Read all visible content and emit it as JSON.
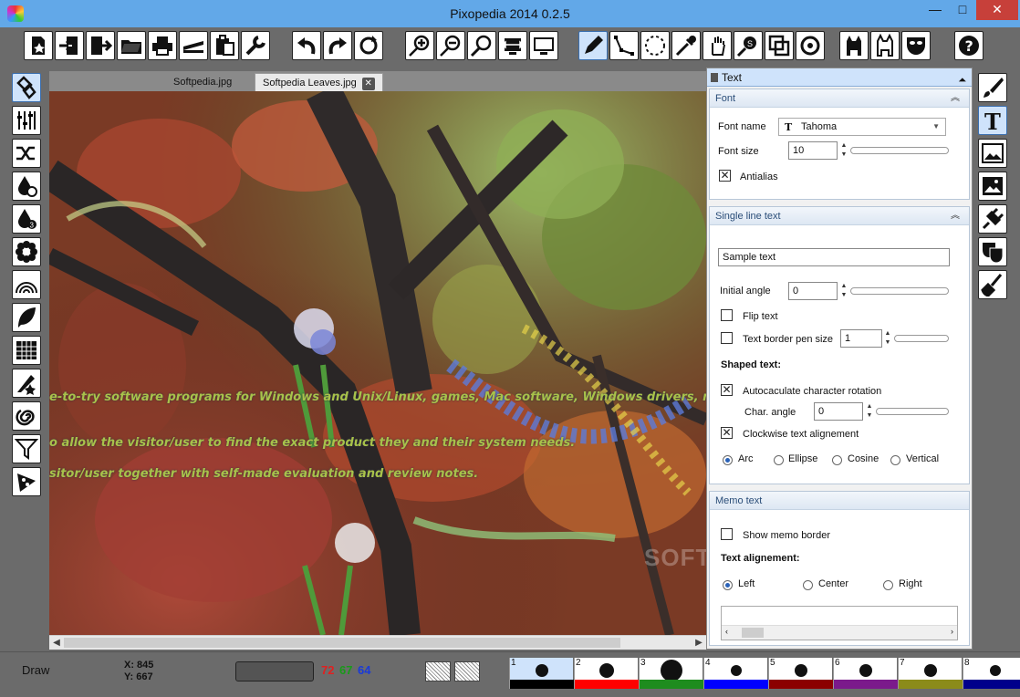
{
  "window": {
    "title": "Pixopedia 2014 0.2.5",
    "min": "—",
    "max": "□",
    "close": "✕"
  },
  "toolbar_icons": [
    "new-icon",
    "import-icon",
    "export-icon",
    "open-folder-icon",
    "print-icon",
    "scanner-icon",
    "clipboard-icon",
    "wrench-icon",
    "undo-icon",
    "redo-icon",
    "refresh-icon",
    "zoom-in-icon",
    "zoom-out-icon",
    "zoom-icon",
    "fit-width-icon",
    "monitor-icon",
    "pen-icon",
    "path-icon",
    "lasso-icon",
    "eyedropper-icon",
    "hand-icon",
    "stamp-icon",
    "crop-icon",
    "rotate-icon",
    "cat-black-icon",
    "cat-white-icon",
    "mask-icon",
    "help-icon"
  ],
  "tabs": [
    {
      "label": "Softpedia.jpg",
      "active": false
    },
    {
      "label": "Softpedia Leaves.jpg",
      "active": true,
      "close": "✕"
    }
  ],
  "canvas": {
    "overlay_lines": [
      "e-to-try software programs for Windows and Unix/Linux, games, Mac software, Windows drivers, mobile",
      "o allow the visitor/user to find the exact product they and their system needs.",
      "sitor/user together with self-made evaluation and review notes."
    ],
    "watermark": "SOFTPEDIA"
  },
  "panel": {
    "title": "Text",
    "font_group": {
      "title": "Font",
      "font_name_label": "Font name",
      "font_name_value": "Tahoma",
      "font_size_label": "Font size",
      "font_size_value": "10",
      "antialias_label": "Antialias",
      "antialias_checked": true
    },
    "single_group": {
      "title": "Single line text",
      "sample_text": "Sample text",
      "initial_angle_label": "Initial angle",
      "initial_angle_value": "0",
      "flip_label": "Flip text",
      "border_label": "Text border pen size",
      "border_value": "1",
      "shaped_label": "Shaped text:",
      "autocalc_label": "Autocaculate character rotation",
      "char_angle_label": "Char. angle",
      "char_angle_value": "0",
      "clockwise_label": "Clockwise text alignement",
      "shapes": [
        "Arc",
        "Ellipse",
        "Cosine",
        "Vertical"
      ]
    },
    "memo_group": {
      "title": "Memo text",
      "show_border_label": "Show memo border",
      "align_label": "Text alignement:",
      "aligns": [
        "Left",
        "Center",
        "Right"
      ]
    }
  },
  "status": {
    "mode": "Draw",
    "x_label": "X: 845",
    "y_label": "Y: 667",
    "r": "72",
    "g": "67",
    "b": "64",
    "brush_colors": [
      "#000000",
      "#ff0000",
      "#1e8c1e",
      "#0000ff",
      "#8b0000",
      "#7b1a8b",
      "#8b8b1a",
      "#00008b"
    ],
    "brush_numbers": [
      "1",
      "2",
      "3",
      "4",
      "5",
      "6",
      "7",
      "8"
    ]
  },
  "colors": {
    "accent": "#cfe3fb",
    "title_bg": "#62a8e8",
    "close_btn": "#c7403a",
    "overlay_text": "#a8c24a"
  }
}
